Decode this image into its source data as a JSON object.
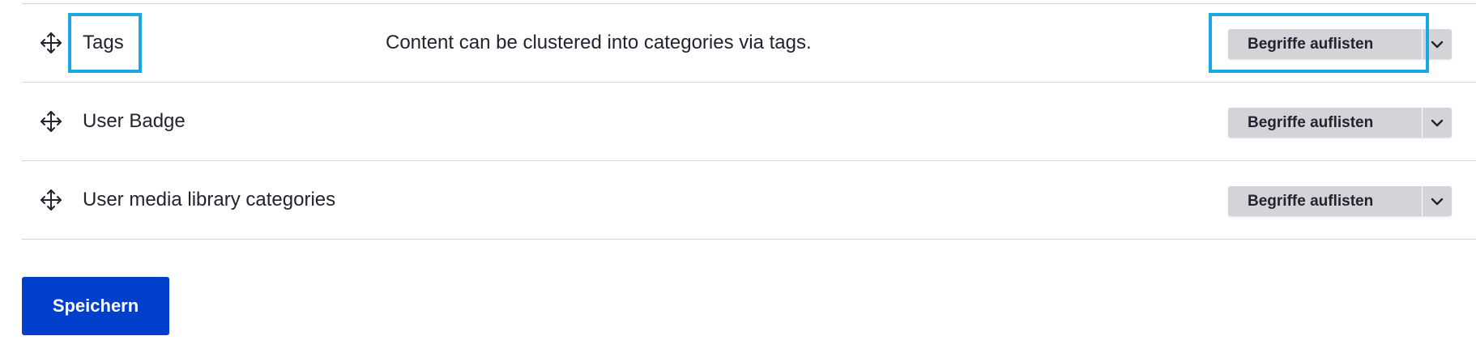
{
  "vocabularies": [
    {
      "name": "Tags",
      "description": "Content can be clustered into categories via tags.",
      "action_label": "Begriffe auflisten",
      "drag_icon": "move-arrows-icon",
      "toggle_icon": "chevron-down-icon"
    },
    {
      "name": "User Badge",
      "description": "",
      "action_label": "Begriffe auflisten",
      "drag_icon": "move-arrows-icon",
      "toggle_icon": "chevron-down-icon"
    },
    {
      "name": "User media library categories",
      "description": "",
      "action_label": "Begriffe auflisten",
      "drag_icon": "move-arrows-icon",
      "toggle_icon": "chevron-down-icon"
    }
  ],
  "form": {
    "save_label": "Speichern"
  },
  "colors": {
    "primary_button": "#003ecc",
    "dropbutton_bg": "#d4d4d8",
    "highlight": "#1ba7e1",
    "row_border": "#d3d4d9",
    "text": "#222330"
  }
}
